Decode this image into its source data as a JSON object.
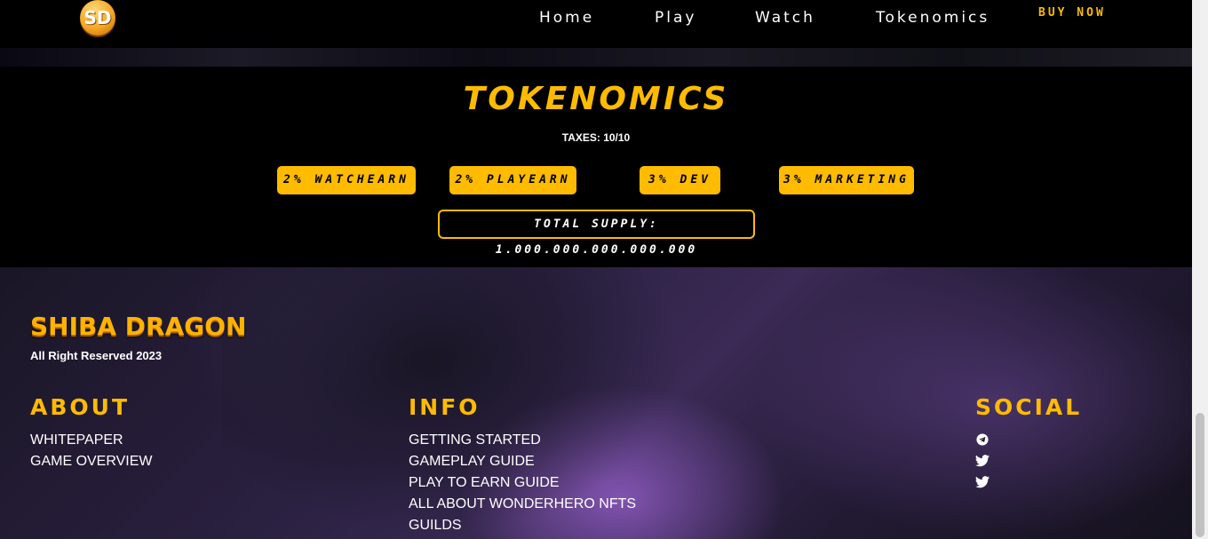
{
  "header": {
    "logo_text": "SD",
    "nav": [
      "Home",
      "Play",
      "Watch",
      "Tokenomics"
    ],
    "buy_now": "BUY NOW"
  },
  "tokenomics": {
    "title": "TOKENOMICS",
    "taxes": "TAXES: 10/10",
    "pills": [
      "2% WATCHEARN",
      "2% PLAYEARN",
      "3% DEV",
      "3% MARKETING"
    ],
    "total_supply": "TOTAL SUPPLY: 1.000.000.000.000.000"
  },
  "footer": {
    "brand": "SHIBA DRAGON",
    "rights": "All Right Reserved 2023",
    "about": {
      "heading": "ABOUT",
      "links": [
        "WHITEPAPER",
        "GAME OVERVIEW"
      ]
    },
    "info": {
      "heading": "INFO",
      "links": [
        "GETTING STARTED",
        "GAMEPLAY GUIDE",
        "PLAY TO EARN GUIDE",
        "ALL ABOUT WONDERHERO NFTS",
        "GUILDS"
      ]
    },
    "social": {
      "heading": "SOCIAL",
      "icons": [
        "telegram-icon",
        "twitter-icon",
        "twitter-icon"
      ]
    }
  },
  "colors": {
    "accent": "#ffbb00",
    "background": "#000000"
  }
}
